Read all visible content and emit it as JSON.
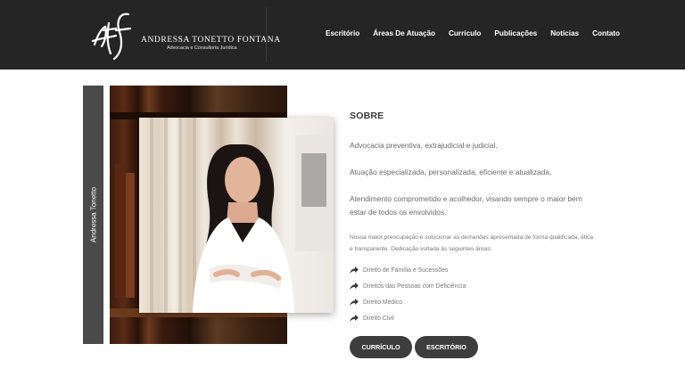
{
  "header": {
    "logo": {
      "monogram": "atf",
      "name": "ANDRESSA TONETTO FONTANA",
      "tagline": "Advocacia e Consultoria Jurídica"
    },
    "nav": [
      "Escritório",
      "Áreas De Atuação",
      "Currículo",
      "Publicações",
      "Notícias",
      "Contato"
    ]
  },
  "profile": {
    "side_label": "Andressa Tonetto"
  },
  "about": {
    "title": "SOBRE",
    "lead": [
      "Advocacia preventiva, extrajudicial e judicial.",
      "Atuação especializada, personalizada, eficiente e atualizada.",
      "Atendimento comprometido e acolhedor, visando sempre o maior bem estar de todos os envolvidos."
    ],
    "body": "Nossa maior preocupação é solucionar as demandas apresentada de forma qualificada, ética e transparente. Dedicação voltada às seguintes áreas:",
    "areas": [
      {
        "label": "Direito de Família e Sucessões",
        "icon": "share-arrow-icon"
      },
      {
        "label": "Direitos das Pessoas com Deficiência",
        "icon": "share-arrow-icon"
      },
      {
        "label": "Direito Médico",
        "icon": "share-arrow-icon"
      },
      {
        "label": "Direito Civil",
        "icon": "share-arrow-icon"
      }
    ],
    "buttons": {
      "curriculo": "CURRÍCULO",
      "escritorio": "ESCRITÓRIO"
    }
  },
  "colors": {
    "header_bg": "#252525",
    "button_bg": "#3d3d3d",
    "side_bar": "#4a4a4a"
  }
}
